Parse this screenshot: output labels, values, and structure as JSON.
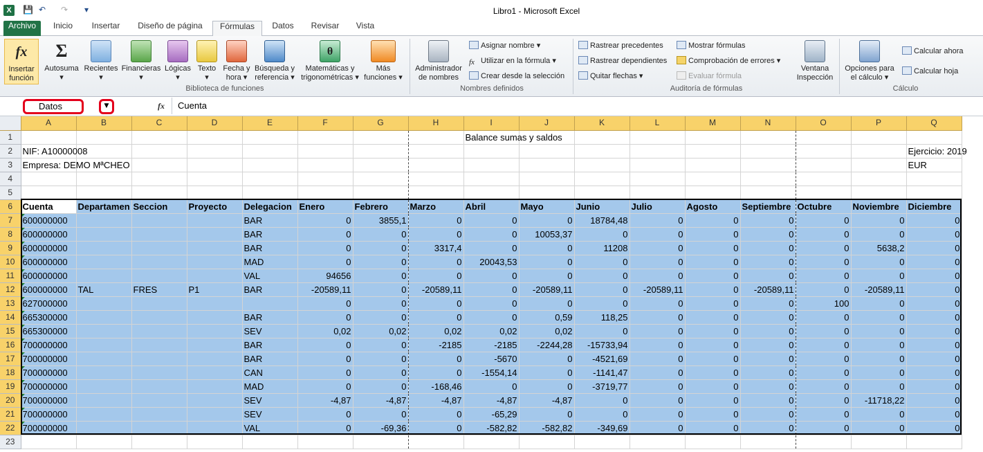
{
  "window": {
    "title": "Libro1  -  Microsoft Excel"
  },
  "quick_access": {
    "save": "💾",
    "undo": "↶",
    "redo": "↷",
    "customize": "▾"
  },
  "tabs": [
    {
      "label": "Archivo"
    },
    {
      "label": "Inicio"
    },
    {
      "label": "Insertar"
    },
    {
      "label": "Diseño de página"
    },
    {
      "label": "Fórmulas"
    },
    {
      "label": "Datos"
    },
    {
      "label": "Revisar"
    },
    {
      "label": "Vista"
    }
  ],
  "ribbon": {
    "insert_function": [
      "Insertar",
      "función"
    ],
    "library": [
      {
        "l1": "Autosuma",
        "l2": "▾"
      },
      {
        "l1": "Recientes",
        "l2": "▾"
      },
      {
        "l1": "Financieras",
        "l2": "▾"
      },
      {
        "l1": "Lógicas",
        "l2": "▾"
      },
      {
        "l1": "Texto",
        "l2": "▾"
      },
      {
        "l1": "Fecha y",
        "l2": "hora ▾"
      },
      {
        "l1": "Búsqueda y",
        "l2": "referencia ▾"
      },
      {
        "l1": "Matemáticas y",
        "l2": "trigonométricas ▾"
      },
      {
        "l1": "Más",
        "l2": "funciones ▾"
      }
    ],
    "library_label": "Biblioteca de funciones",
    "name_manager": [
      "Administrador",
      "de nombres"
    ],
    "defined_names": [
      "Asignar nombre ▾",
      "Utilizar en la fórmula ▾",
      "Crear desde la selección"
    ],
    "defined_names_label": "Nombres definidos",
    "audit_col1": [
      "Rastrear precedentes",
      "Rastrear dependientes",
      "Quitar flechas ▾"
    ],
    "audit_col2": [
      "Mostrar fórmulas",
      "Comprobación de errores ▾",
      "Evaluar fórmula"
    ],
    "watch_window": [
      "Ventana",
      "Inspección"
    ],
    "audit_label": "Auditoría de fórmulas",
    "calc_options": [
      "Opciones para",
      "el cálculo ▾"
    ],
    "calc_now": "Calcular ahora",
    "calc_sheet": "Calcular hoja",
    "calc_label": "Cálculo"
  },
  "formula_bar": {
    "name_box": "Datos",
    "dropdown": "▼",
    "fx": "fx",
    "content": "Cuenta"
  },
  "columns": [
    "A",
    "B",
    "C",
    "D",
    "E",
    "F",
    "G",
    "H",
    "I",
    "J",
    "K",
    "L",
    "M",
    "N",
    "O",
    "P",
    "Q"
  ],
  "cells": {
    "r1_I": "Balance sumas y saldos",
    "r2_A": "NIF: A10000008",
    "r2_Q": "Ejercicio: 2019",
    "r3_A": "Empresa: DEMO MªCHEO",
    "r3_Q": "EUR"
  },
  "headers": [
    "Cuenta",
    "Departamen",
    "Seccion",
    "Proyecto",
    "Delegacion",
    "Enero",
    "Febrero",
    "Marzo",
    "Abril",
    "Mayo",
    "Junio",
    "Julio",
    "Agosto",
    "Septiembre",
    "Octubre",
    "Noviembre",
    "Diciembre"
  ],
  "rows": [
    [
      "600000000",
      "",
      "",
      "",
      "BAR",
      "0",
      "3855,1",
      "0",
      "0",
      "0",
      "18784,48",
      "0",
      "0",
      "0",
      "0",
      "0",
      "0"
    ],
    [
      "600000000",
      "",
      "",
      "",
      "BAR",
      "0",
      "0",
      "0",
      "0",
      "10053,37",
      "0",
      "0",
      "0",
      "0",
      "0",
      "0",
      "0"
    ],
    [
      "600000000",
      "",
      "",
      "",
      "BAR",
      "0",
      "0",
      "3317,4",
      "0",
      "0",
      "11208",
      "0",
      "0",
      "0",
      "0",
      "5638,2",
      "0"
    ],
    [
      "600000000",
      "",
      "",
      "",
      "MAD",
      "0",
      "0",
      "0",
      "20043,53",
      "0",
      "0",
      "0",
      "0",
      "0",
      "0",
      "0",
      "0"
    ],
    [
      "600000000",
      "",
      "",
      "",
      "VAL",
      "94656",
      "0",
      "0",
      "0",
      "0",
      "0",
      "0",
      "0",
      "0",
      "0",
      "0",
      "0"
    ],
    [
      "600000000",
      "TAL",
      "FRES",
      "P1",
      "BAR",
      "-20589,11",
      "0",
      "-20589,11",
      "0",
      "-20589,11",
      "0",
      "-20589,11",
      "0",
      "-20589,11",
      "0",
      "-20589,11",
      "0"
    ],
    [
      "627000000",
      "",
      "",
      "",
      "",
      "0",
      "0",
      "0",
      "0",
      "0",
      "0",
      "0",
      "0",
      "0",
      "100",
      "0",
      "0"
    ],
    [
      "665300000",
      "",
      "",
      "",
      "BAR",
      "0",
      "0",
      "0",
      "0",
      "0,59",
      "118,25",
      "0",
      "0",
      "0",
      "0",
      "0",
      "0"
    ],
    [
      "665300000",
      "",
      "",
      "",
      "SEV",
      "0,02",
      "0,02",
      "0,02",
      "0,02",
      "0,02",
      "0",
      "0",
      "0",
      "0",
      "0",
      "0",
      "0"
    ],
    [
      "700000000",
      "",
      "",
      "",
      "BAR",
      "0",
      "0",
      "-2185",
      "-2185",
      "-2244,28",
      "-15733,94",
      "0",
      "0",
      "0",
      "0",
      "0",
      "0"
    ],
    [
      "700000000",
      "",
      "",
      "",
      "BAR",
      "0",
      "0",
      "0",
      "-5670",
      "0",
      "-4521,69",
      "0",
      "0",
      "0",
      "0",
      "0",
      "0"
    ],
    [
      "700000000",
      "",
      "",
      "",
      "CAN",
      "0",
      "0",
      "0",
      "-1554,14",
      "0",
      "-1141,47",
      "0",
      "0",
      "0",
      "0",
      "0",
      "0"
    ],
    [
      "700000000",
      "",
      "",
      "",
      "MAD",
      "0",
      "0",
      "-168,46",
      "0",
      "0",
      "-3719,77",
      "0",
      "0",
      "0",
      "0",
      "0",
      "0"
    ],
    [
      "700000000",
      "",
      "",
      "",
      "SEV",
      "-4,87",
      "-4,87",
      "-4,87",
      "-4,87",
      "-4,87",
      "0",
      "0",
      "0",
      "0",
      "0",
      "-11718,22",
      "0"
    ],
    [
      "700000000",
      "",
      "",
      "",
      "SEV",
      "0",
      "0",
      "0",
      "-65,29",
      "0",
      "0",
      "0",
      "0",
      "0",
      "0",
      "0",
      "0"
    ],
    [
      "700000000",
      "",
      "",
      "",
      "VAL",
      "0",
      "-69,36",
      "0",
      "-582,82",
      "-582,82",
      "-349,69",
      "0",
      "0",
      "0",
      "0",
      "0",
      "0"
    ]
  ],
  "row_numbers": [
    "1",
    "2",
    "3",
    "4",
    "5",
    "6",
    "7",
    "8",
    "9",
    "10",
    "11",
    "12",
    "13",
    "14",
    "15",
    "16",
    "17",
    "18",
    "19",
    "20",
    "21",
    "22",
    "23"
  ]
}
